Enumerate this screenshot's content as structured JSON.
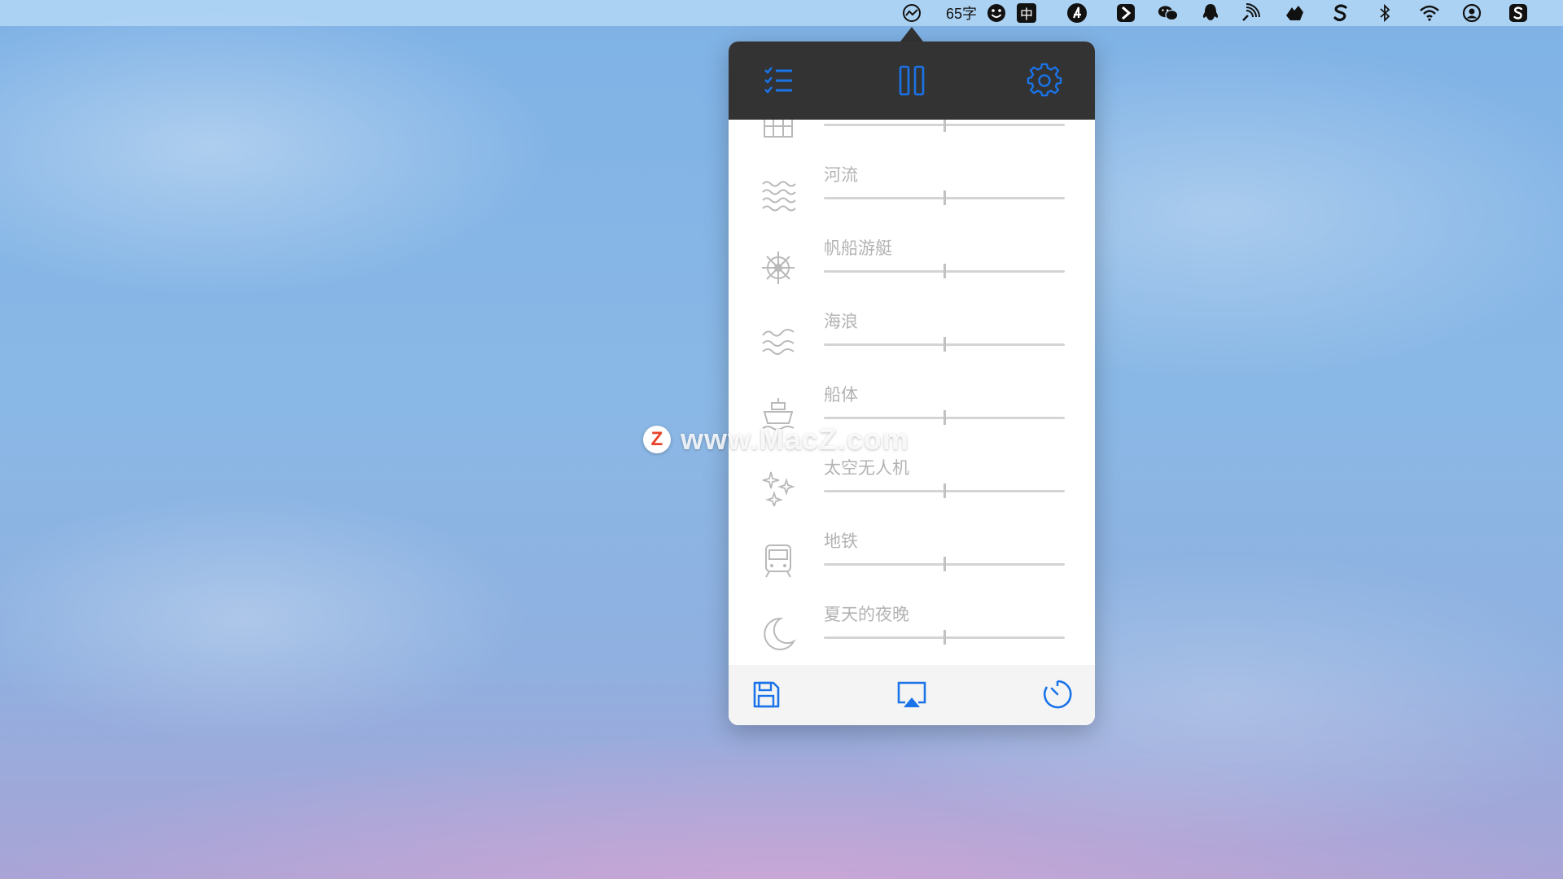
{
  "menubar": {
    "word_count": "65字",
    "input_method": "中",
    "icons": [
      "noizio-icon",
      "emoji-icon",
      "input-method-icon",
      "app-a-icon",
      "app-b-icon",
      "wechat-icon",
      "qq-icon",
      "cast-icon",
      "bird-icon",
      "s-app-icon",
      "bluetooth-icon",
      "wifi-icon",
      "user-icon",
      "s-box-icon"
    ]
  },
  "popover": {
    "header": {
      "list_icon": "checklist-icon",
      "pause_icon": "pause-icon",
      "settings_icon": "gear-icon"
    },
    "sounds": [
      {
        "label": "",
        "icon": "building-icon",
        "level": 0.5
      },
      {
        "label": "河流",
        "icon": "river-icon",
        "level": 0.5
      },
      {
        "label": "帆船游艇",
        "icon": "ship-wheel-icon",
        "level": 0.5
      },
      {
        "label": "海浪",
        "icon": "waves-icon",
        "level": 0.5
      },
      {
        "label": "船体",
        "icon": "ship-icon",
        "level": 0.5
      },
      {
        "label": "太空无人机",
        "icon": "sparkles-icon",
        "level": 0.5
      },
      {
        "label": "地铁",
        "icon": "train-icon",
        "level": 0.5
      },
      {
        "label": "夏天的夜晚",
        "icon": "moon-icon",
        "level": 0.5
      }
    ],
    "footer": {
      "save_icon": "save-icon",
      "airplay_icon": "airplay-icon",
      "timer_icon": "timer-icon"
    }
  },
  "watermark": {
    "logo_letter": "Z",
    "text": "www.MacZ.com"
  },
  "colors": {
    "accent": "#1a73e8",
    "header_bg": "#333333",
    "label": "#b3b3b3"
  }
}
